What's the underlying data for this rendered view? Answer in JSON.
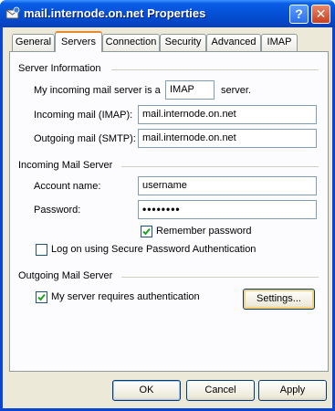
{
  "window": {
    "title": "mail.internode.on.net Properties",
    "help_glyph": "?",
    "close_glyph": "✕"
  },
  "tabs": [
    {
      "label": "General"
    },
    {
      "label": "Servers"
    },
    {
      "label": "Connection"
    },
    {
      "label": "Security"
    },
    {
      "label": "Advanced"
    },
    {
      "label": "IMAP"
    }
  ],
  "active_tab": "Servers",
  "server_info": {
    "group_label": "Server Information",
    "incoming_type_prefix": "My incoming mail server is a",
    "incoming_type_value": "IMAP",
    "incoming_type_suffix": "server.",
    "incoming_label": "Incoming mail (IMAP):",
    "incoming_value": "mail.internode.on.net",
    "outgoing_label": "Outgoing mail (SMTP):",
    "outgoing_value": "mail.internode.on.net"
  },
  "incoming_server": {
    "group_label": "Incoming Mail Server",
    "account_label": "Account name:",
    "account_value": "username",
    "password_label": "Password:",
    "password_value": "••••••••",
    "remember_label": "Remember password",
    "remember_checked": true,
    "spa_label": "Log on using Secure Password Authentication",
    "spa_checked": false
  },
  "outgoing_server": {
    "group_label": "Outgoing Mail Server",
    "auth_label": "My server requires authentication",
    "auth_checked": true,
    "settings_button": "Settings..."
  },
  "footer": {
    "ok": "OK",
    "cancel": "Cancel",
    "apply": "Apply"
  },
  "colors": {
    "titlebar": "#0552d8",
    "dialog_bg": "#ece9d8",
    "checkmark": "#21a121",
    "active_tab_accent": "#e68b2c"
  }
}
